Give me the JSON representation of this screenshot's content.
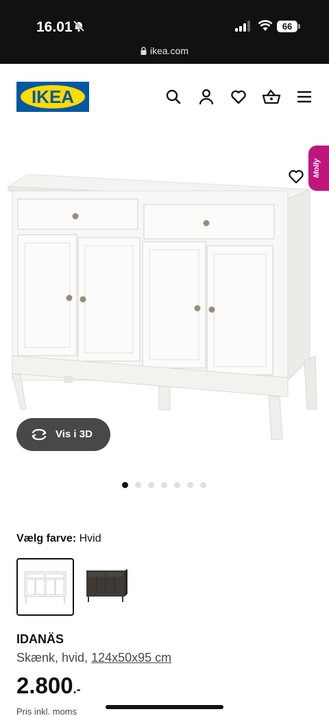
{
  "status_bar": {
    "time": "16.01",
    "battery": "66",
    "url": "ikea.com"
  },
  "header": {
    "logo_text": "IKEA",
    "icons": [
      "search-icon",
      "profile-icon",
      "heart-icon",
      "basket-icon",
      "menu-icon"
    ]
  },
  "gallery": {
    "assistant_label": "Molly",
    "view_3d_label": "Vis i 3D",
    "image_count": 7,
    "active_index": 0
  },
  "color_picker": {
    "label": "Vælg farve:",
    "selected": "Hvid",
    "options_colors": [
      "#ffffff",
      "#3f3a35"
    ]
  },
  "product": {
    "name": "IDANÄS",
    "description": "Skænk, hvid,",
    "dimensions": "124x50x95 cm",
    "price": "2.800",
    "price_suffix": ".-",
    "price_note": "Pris inkl. moms"
  },
  "colors": {
    "ikea_blue": "#0058a3",
    "ikea_yellow": "#ffdb00",
    "molly_pink": "#c0157f",
    "button_dark": "#484848"
  }
}
